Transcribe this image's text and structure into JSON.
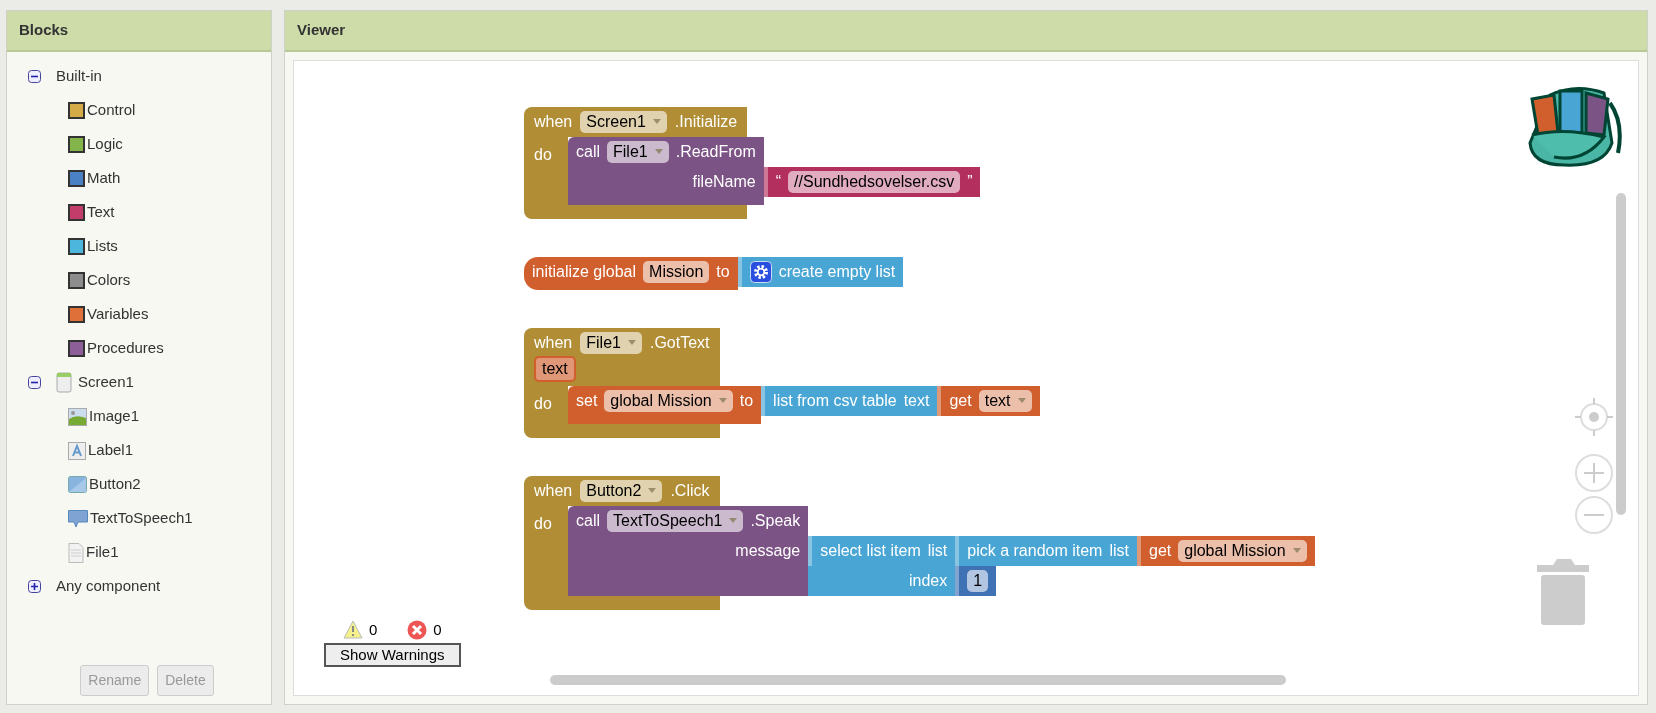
{
  "blocks_panel": {
    "title": "Blocks",
    "tree": [
      {
        "label": "Built-in",
        "kind": "group",
        "expanded": true,
        "children": [
          {
            "label": "Control",
            "kind": "category",
            "color": "#d4ab46"
          },
          {
            "label": "Logic",
            "kind": "category",
            "color": "#84b54a"
          },
          {
            "label": "Math",
            "kind": "category",
            "color": "#4a80c4"
          },
          {
            "label": "Text",
            "kind": "category",
            "color": "#c33d6b"
          },
          {
            "label": "Lists",
            "kind": "category",
            "color": "#4cb6dd"
          },
          {
            "label": "Colors",
            "kind": "category",
            "color": "#8d8d8d"
          },
          {
            "label": "Variables",
            "kind": "category",
            "color": "#e0703a"
          },
          {
            "label": "Procedures",
            "kind": "category",
            "color": "#8d5f98"
          }
        ]
      },
      {
        "label": "Screen1",
        "kind": "screen",
        "expanded": true,
        "children": [
          {
            "label": "Image1",
            "kind": "image"
          },
          {
            "label": "Label1",
            "kind": "label"
          },
          {
            "label": "Button2",
            "kind": "button"
          },
          {
            "label": "TextToSpeech1",
            "kind": "speech"
          },
          {
            "label": "File1",
            "kind": "file"
          }
        ]
      },
      {
        "label": "Any component",
        "kind": "group",
        "expanded": false
      }
    ],
    "buttons": [
      {
        "label": "Rename",
        "disabled": true
      },
      {
        "label": "Delete",
        "disabled": true
      }
    ]
  },
  "viewer": {
    "title": "Viewer",
    "block_groups": [
      {
        "kind": "event",
        "color": "#b18e35",
        "header": [
          [
            {
              "kind": "label",
              "text": "when"
            },
            {
              "kind": "dropdown",
              "text": "Screen1"
            },
            {
              "kind": "label",
              "text": ".Initialize"
            }
          ]
        ],
        "do_label": "do",
        "body": {
          "kind": "statement",
          "color": "#7c5385",
          "lines": [
            {
              "tokens": [
                {
                  "kind": "label",
                  "text": "call"
                },
                {
                  "kind": "dropdown",
                  "text": "File1"
                },
                {
                  "kind": "label",
                  "text": ".ReadFrom"
                }
              ]
            },
            {
              "tokens": [
                {
                  "kind": "label",
                  "text": "fileName"
                }
              ],
              "input": {
                "kind": "value",
                "color": "#b32f5e",
                "lines": [
                  {
                    "tokens": [
                      {
                        "kind": "label",
                        "text": "“"
                      },
                      {
                        "kind": "string",
                        "text": "//Sundhedsovelser.csv"
                      },
                      {
                        "kind": "label",
                        "text": "”"
                      }
                    ]
                  }
                ]
              }
            }
          ]
        }
      },
      {
        "kind": "global",
        "color": "#d05f2d",
        "lines": [
          {
            "tokens": [
              {
                "kind": "label",
                "text": "initialize global"
              },
              {
                "kind": "name",
                "text": "Mission"
              },
              {
                "kind": "label",
                "text": "to"
              }
            ],
            "input": {
              "kind": "value",
              "color": "#49a6d4",
              "lines": [
                {
                  "tokens": [
                    {
                      "kind": "mutator"
                    },
                    {
                      "kind": "label",
                      "text": "create empty list"
                    }
                  ]
                }
              ]
            }
          }
        ]
      },
      {
        "kind": "event",
        "color": "#b18e35",
        "header": [
          [
            {
              "kind": "label",
              "text": "when"
            },
            {
              "kind": "dropdown",
              "text": "File1"
            },
            {
              "kind": "label",
              "text": ".GotText"
            }
          ],
          [
            {
              "kind": "param",
              "text": "text",
              "color": "#d05f2d"
            }
          ]
        ],
        "do_label": "do",
        "body": {
          "kind": "statement",
          "color": "#d05f2d",
          "lines": [
            {
              "tokens": [
                {
                  "kind": "label",
                  "text": "set"
                },
                {
                  "kind": "dropdown",
                  "text": "global Mission"
                },
                {
                  "kind": "label",
                  "text": "to"
                }
              ],
              "input": {
                "kind": "value",
                "color": "#49a6d4",
                "lines": [
                  {
                    "tokens": [
                      {
                        "kind": "label",
                        "text": "list from csv table"
                      },
                      {
                        "kind": "label",
                        "text": "text"
                      }
                    ],
                    "input": {
                      "kind": "value",
                      "color": "#d05f2d",
                      "lines": [
                        {
                          "tokens": [
                            {
                              "kind": "label",
                              "text": "get"
                            },
                            {
                              "kind": "dropdown",
                              "text": "text"
                            }
                          ]
                        }
                      ]
                    }
                  }
                ]
              }
            }
          ]
        }
      },
      {
        "kind": "event",
        "color": "#b18e35",
        "header": [
          [
            {
              "kind": "label",
              "text": "when"
            },
            {
              "kind": "dropdown",
              "text": "Button2"
            },
            {
              "kind": "label",
              "text": ".Click"
            }
          ]
        ],
        "do_label": "do",
        "body": {
          "kind": "statement",
          "color": "#7c5385",
          "lines": [
            {
              "tokens": [
                {
                  "kind": "label",
                  "text": "call"
                },
                {
                  "kind": "dropdown",
                  "text": "TextToSpeech1"
                },
                {
                  "kind": "label",
                  "text": ".Speak"
                }
              ]
            },
            {
              "tokens": [
                {
                  "kind": "label",
                  "text": "message"
                }
              ],
              "input": {
                "kind": "value",
                "color": "#49a6d4",
                "lines": [
                  {
                    "tokens": [
                      {
                        "kind": "label",
                        "text": "select list item"
                      },
                      {
                        "kind": "label",
                        "text": "list"
                      }
                    ],
                    "input": {
                      "kind": "value",
                      "color": "#49a6d4",
                      "lines": [
                        {
                          "tokens": [
                            {
                              "kind": "label",
                              "text": "pick a random item"
                            },
                            {
                              "kind": "label",
                              "text": "list"
                            }
                          ],
                          "input": {
                            "kind": "value",
                            "color": "#d05f2d",
                            "lines": [
                              {
                                "tokens": [
                                  {
                                    "kind": "label",
                                    "text": "get"
                                  },
                                  {
                                    "kind": "dropdown",
                                    "text": "global Mission"
                                  }
                                ]
                              }
                            ]
                          }
                        }
                      ]
                    }
                  },
                  {
                    "tokens": [
                      {
                        "kind": "label",
                        "text": "index"
                      }
                    ],
                    "input": {
                      "kind": "value",
                      "color": "#3f71b5",
                      "lines": [
                        {
                          "tokens": [
                            {
                              "kind": "number",
                              "text": "1"
                            }
                          ]
                        }
                      ]
                    }
                  }
                ]
              }
            }
          ]
        }
      }
    ],
    "warnings": {
      "warning_count": "0",
      "error_count": "0",
      "button": "Show Warnings"
    }
  }
}
